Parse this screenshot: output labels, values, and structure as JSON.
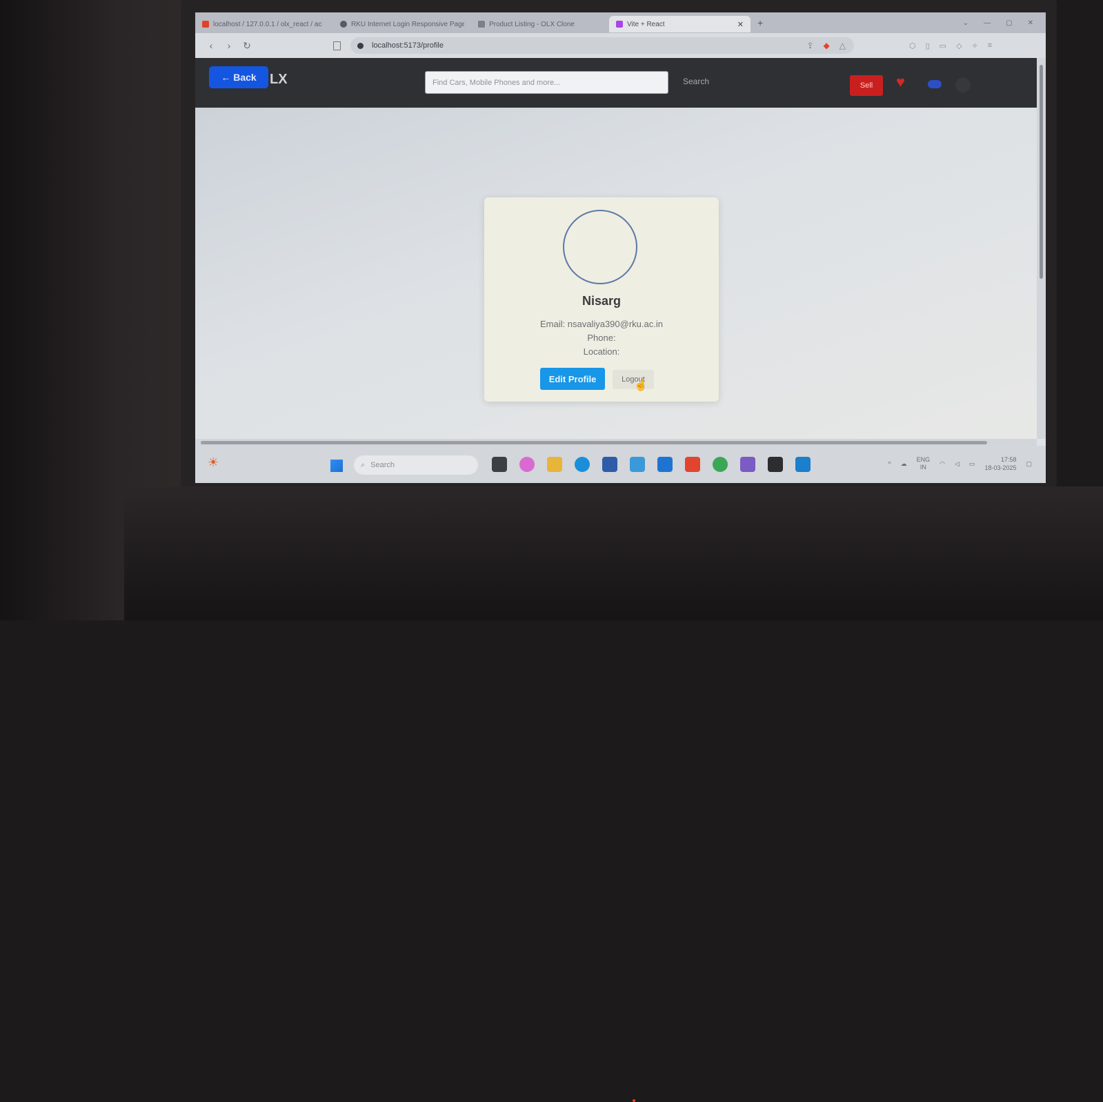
{
  "browser": {
    "tabs": [
      {
        "title": "localhost / 127.0.0.1 / olx_react / ac",
        "active": false,
        "color": "#e0412a"
      },
      {
        "title": "RKU Internet Login Responsive Page",
        "active": false,
        "color": "#555b66"
      },
      {
        "title": "Product Listing - OLX Clone",
        "active": false,
        "color": "#7a7f88"
      },
      {
        "title": "Vite + React",
        "active": true,
        "color": "#a845e8"
      }
    ],
    "new_tab": "+",
    "url": "localhost:5173/profile"
  },
  "header": {
    "back_label": "← Back",
    "logo_fragment": "LX",
    "search_placeholder": "Find Cars, Mobile Phones and more...",
    "search_label": "Search",
    "sell_label": "Sell"
  },
  "profile": {
    "name": "Nisarg",
    "email": "Email: nsavaliya390@rku.ac.in",
    "phone": "Phone:",
    "location": "Location:",
    "edit_label": "Edit Profile",
    "logout_label": "Logout"
  },
  "taskbar": {
    "search_placeholder": "Search",
    "lang": "ENG",
    "region": "IN",
    "time": "17:58",
    "date": "18-03-2025"
  },
  "colors": {
    "header_bg": "#2f3034",
    "back_button": "#1556e0",
    "sell_button": "#c9201f",
    "edit_button": "#1896e8"
  }
}
